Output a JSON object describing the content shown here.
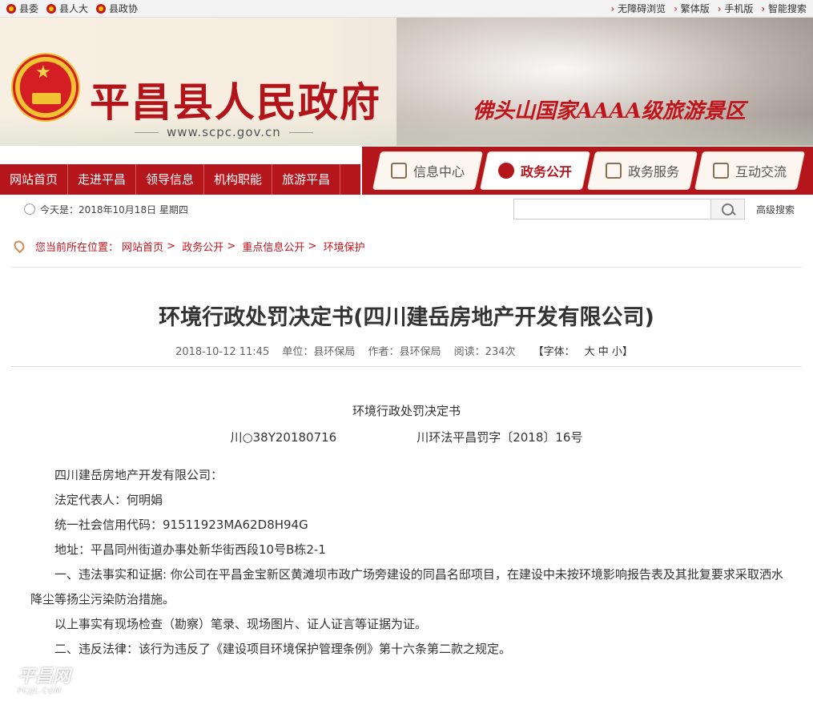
{
  "topbar": {
    "left_links": [
      "县委",
      "县人大",
      "县政协"
    ],
    "right_links": [
      "无障碍浏览",
      "繁体版",
      "手机版",
      "智能搜索"
    ]
  },
  "banner": {
    "site_name": "平昌县人民政府",
    "site_url": "www.scpc.gov.cn",
    "slogan": "佛头山国家AAAA级旅游景区"
  },
  "nav": {
    "main_items": [
      "网站首页",
      "走进平昌",
      "领导信息",
      "机构职能",
      "旅游平昌"
    ],
    "tabs": [
      {
        "label": "信息中心",
        "icon": "document-icon"
      },
      {
        "label": "政务公开",
        "icon": "microphone-icon"
      },
      {
        "label": "政务服务",
        "icon": "monitor-icon"
      },
      {
        "label": "互动交流",
        "icon": "chat-icon"
      }
    ]
  },
  "datebar": {
    "today": "今天是：2018年10月18日  星期四",
    "search_placeholder": "",
    "advanced_search": "高级搜索"
  },
  "breadcrumb": {
    "prefix": "您当前所在位置：",
    "items": [
      "网站首页",
      "政务公开",
      "重点信息公开",
      "环境保护"
    ]
  },
  "article": {
    "title": "环境行政处罚决定书(四川建岳房地产开发有限公司)",
    "date": "2018-10-12 11:45",
    "unit": "单位：县环保局",
    "author": "作者：县环保局",
    "reads": "阅读：234次",
    "font_size_label": "【字体：",
    "font_size_options": "大 中 小】",
    "doc_heading": "环境行政处罚决定书",
    "doc_no_left": "川○38Y20180716",
    "doc_no_right": "川环法平昌罚字〔2018〕16号",
    "paragraphs": [
      "四川建岳房地产开发有限公司：",
      "法定代表人：何明娟",
      "统一社会信用代码：91511923MA62D8H94G",
      "地址：平昌同州街道办事处新华街西段10号B栋2-1",
      "一、违法事实和证据: 你公司在平昌金宝新区黄滩坝市政广场旁建设的同昌名邸项目，在建设中未按环境影响报告表及其批复要求采取洒水降尘等扬尘污染防治措施。",
      "以上事实有现场检查（勘察）笔录、现场图片、证人证言等证据为证。",
      "二、违反法律：该行为违反了《建设项目环境保护管理条例》第十六条第二款之规定。"
    ]
  },
  "watermark": {
    "text": "平昌网",
    "sub": "PCJJL.COM"
  }
}
